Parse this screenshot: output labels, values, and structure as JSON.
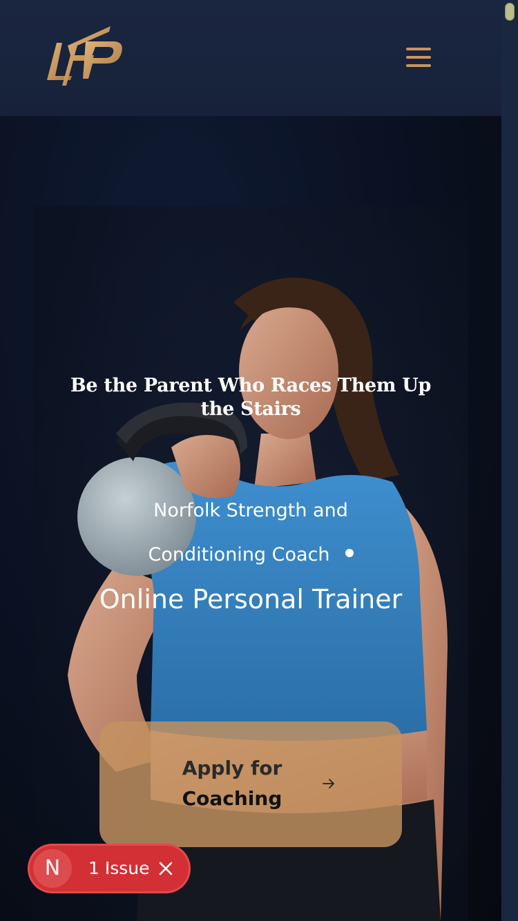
{
  "header": {
    "logo_text": "LFP",
    "menu_icon": "hamburger-menu-icon"
  },
  "hero": {
    "headline": "Be the Parent Who Races Them Up the Stairs",
    "subtitle_line1": "Norfolk Strength and",
    "subtitle_line2": "Conditioning Coach",
    "subtitle_secondary": "Online Personal Trainer",
    "cta_line1": "Apply for",
    "cta_line2": "Coaching",
    "cta_icon": "arrow-right-icon"
  },
  "issue_badge": {
    "initial": "N",
    "label": "1 Issue",
    "close_icon": "close-icon"
  },
  "colors": {
    "header_bg": "#1a2540",
    "accent_gold": "#c9955f",
    "cta_bg": "#c49260",
    "issue_red": "#d33035"
  }
}
